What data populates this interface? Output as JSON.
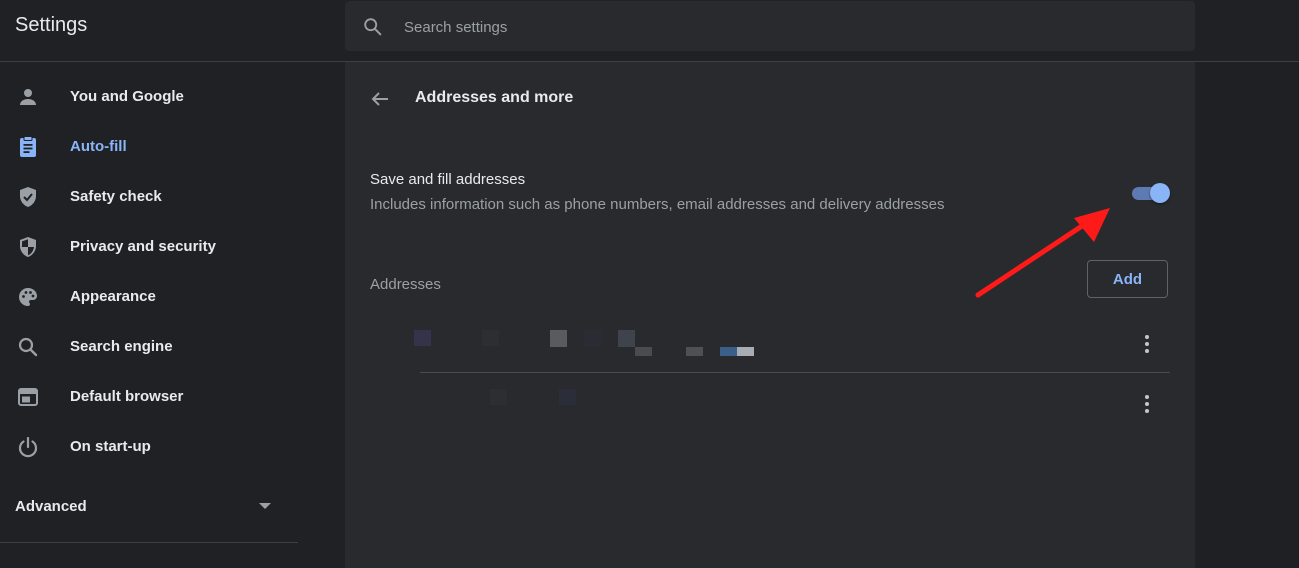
{
  "header": {
    "title": "Settings",
    "search_placeholder": "Search settings"
  },
  "sidebar": {
    "items": [
      {
        "label": "You and Google",
        "icon": "person-icon"
      },
      {
        "label": "Auto-fill",
        "icon": "clipboard-icon",
        "active": true
      },
      {
        "label": "Safety check",
        "icon": "shield-check-icon"
      },
      {
        "label": "Privacy and security",
        "icon": "shield-half-icon"
      },
      {
        "label": "Appearance",
        "icon": "palette-icon"
      },
      {
        "label": "Search engine",
        "icon": "search-icon"
      },
      {
        "label": "Default browser",
        "icon": "browser-window-icon"
      },
      {
        "label": "On start-up",
        "icon": "power-icon"
      }
    ],
    "advanced_label": "Advanced"
  },
  "main": {
    "title": "Addresses and more",
    "setting": {
      "title": "Save and fill addresses",
      "description": "Includes information such as phone numbers, email addresses and delivery addresses",
      "enabled": true
    },
    "addresses_label": "Addresses",
    "add_label": "Add"
  },
  "colors": {
    "background": "#202124",
    "card": "#292a2d",
    "accent": "#8ab4f8",
    "annotation_arrow": "#ff1a1a"
  }
}
